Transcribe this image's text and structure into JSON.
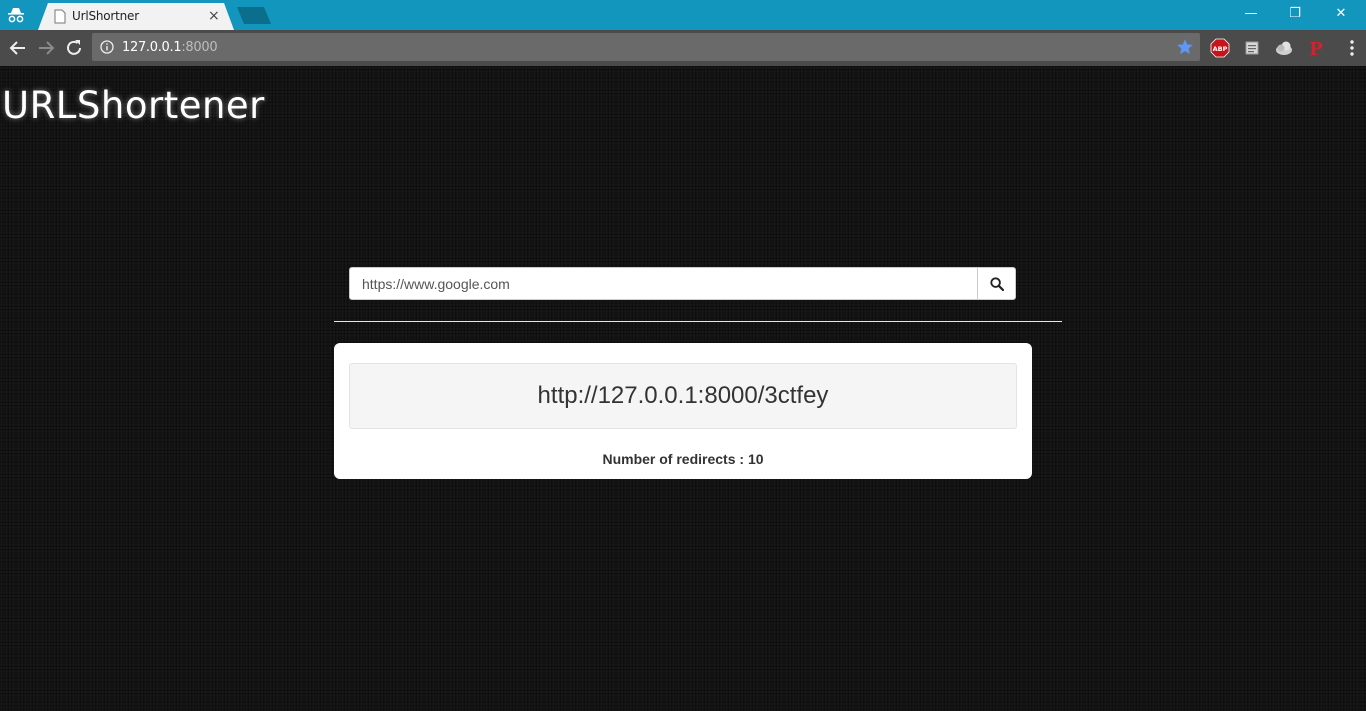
{
  "browser": {
    "tab_title": "UrlShortner",
    "tab_close": "×",
    "url_host": "127.0.0.1",
    "url_port": ":8000",
    "window_controls": {
      "minimize": "—",
      "restore": "❐",
      "close": "✕"
    }
  },
  "page": {
    "brand": "URLShortener",
    "search": {
      "value": "https://www.google.com"
    },
    "result": {
      "short_url": "http://127.0.0.1:8000/3ctfey",
      "redirects_label": "Number of redirects : 10"
    }
  }
}
